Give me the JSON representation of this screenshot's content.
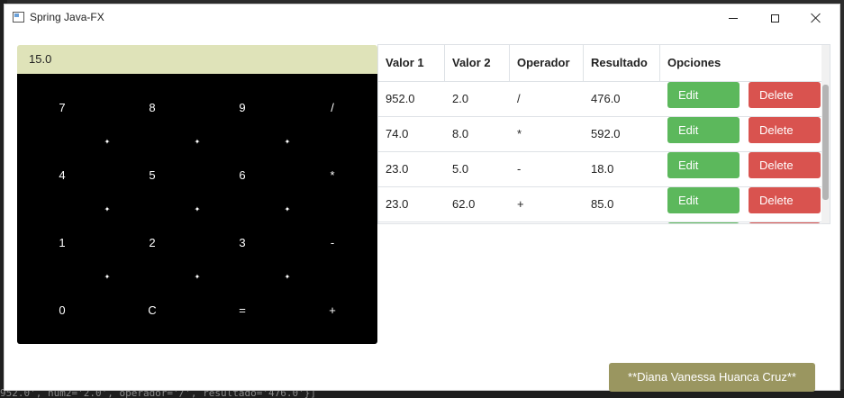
{
  "window": {
    "title": "Spring Java-FX"
  },
  "calculator": {
    "display": "15.0",
    "keys": [
      "7",
      "8",
      "9",
      "/",
      "4",
      "5",
      "6",
      "*",
      "1",
      "2",
      "3",
      "-",
      "0",
      "C",
      "=",
      "+"
    ]
  },
  "table": {
    "headers": [
      "Valor 1",
      "Valor 2",
      "Operador",
      "Resultado",
      "Opciones"
    ],
    "rows": [
      {
        "v1": "952.0",
        "v2": "2.0",
        "op": "/",
        "res": "476.0"
      },
      {
        "v1": "74.0",
        "v2": "8.0",
        "op": "*",
        "res": "592.0"
      },
      {
        "v1": "23.0",
        "v2": "5.0",
        "op": "-",
        "res": "18.0"
      },
      {
        "v1": "23.0",
        "v2": "62.0",
        "op": "+",
        "res": "85.0"
      }
    ],
    "edit_label": "Edit",
    "delete_label": "Delete"
  },
  "author_button": "**Diana Vanessa Huanca Cruz**",
  "console_text": "952.0', num2='2.0', operador='/', resultado='476.0'}]",
  "colors": {
    "display_bg": "#dfe3b9",
    "keypad_bg": "#000000",
    "edit": "#5cb85c",
    "delete": "#d9534f",
    "author": "#9a9660"
  }
}
